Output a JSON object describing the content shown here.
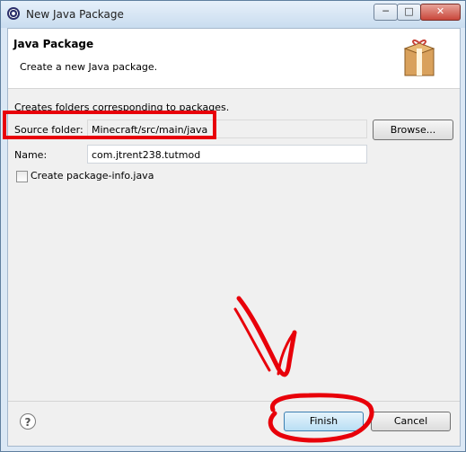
{
  "window": {
    "title": "New Java Package",
    "minimize_label": "─",
    "maximize_label": "□",
    "close_label": "✕"
  },
  "banner": {
    "title": "Java Package",
    "description": "Create a new Java package."
  },
  "form": {
    "intro": "Creates folders corresponding to packages.",
    "source_folder_label": "Source folder:",
    "source_folder_value": "Minecraft/src/main/java",
    "browse_label": "Browse...",
    "name_label": "Name:",
    "name_value": "com.jtrent238.tutmod",
    "create_package_info_label": "Create package-info.java",
    "create_package_info_checked": false
  },
  "footer": {
    "help_label": "?",
    "finish_label": "Finish",
    "cancel_label": "Cancel"
  },
  "colors": {
    "annotation": "#e8000a",
    "titlebar": "#c9dcef"
  },
  "icons": [
    "eclipse-app-icon",
    "package-icon",
    "help-icon"
  ]
}
